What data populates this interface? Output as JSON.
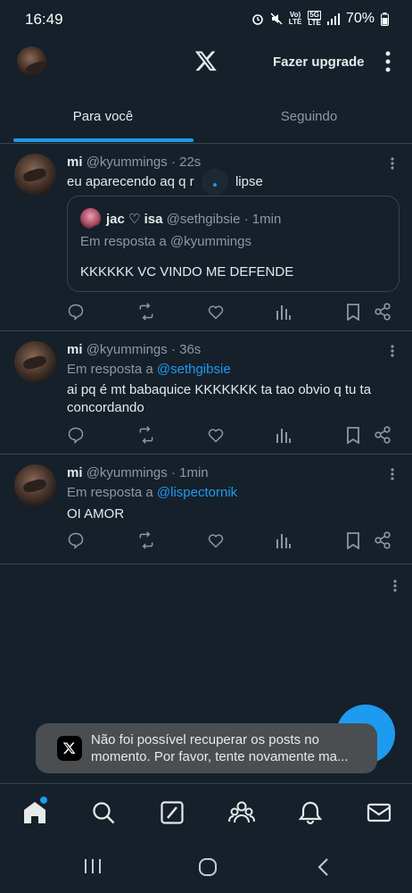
{
  "status_bar": {
    "time": "16:49",
    "volte_top": "Vo)",
    "volte_bottom": "LTE",
    "net_top": "5G",
    "net_bottom": "LTE",
    "battery": "70%"
  },
  "header": {
    "logo": "x-logo-icon",
    "upgrade_label": "Fazer upgrade"
  },
  "tabs": [
    {
      "label": "Para você",
      "active": true
    },
    {
      "label": "Seguindo",
      "active": false
    }
  ],
  "posts": [
    {
      "name": "mi",
      "handle": "@kyummings",
      "time": "· 22s",
      "text": "eu aparecendo aq q r",
      "text_tail": "lipse",
      "quote": {
        "name": "jac ♡ isa",
        "handle": "@sethgibsie",
        "time": "· 1min",
        "reply_line": "Em resposta a @kyummings",
        "text": "KKKKKK  VC VINDO ME DEFENDE"
      }
    },
    {
      "name": "mi",
      "handle": "@kyummings",
      "time": "· 36s",
      "reply_prefix": "Em resposta a",
      "reply_to": "@sethgibsie",
      "text": "ai pq é mt babaquice KKKKKKK ta tao obvio q tu ta concordando"
    },
    {
      "name": "mi",
      "handle": "@kyummings",
      "time": "· 1min",
      "reply_prefix": "Em resposta a",
      "reply_to": "@lispectornik",
      "text": "OI AMOR"
    }
  ],
  "toast": {
    "message": "Não foi possível recuperar os posts no momento. Por favor, tente novamente ma..."
  },
  "colors": {
    "background": "#15202b",
    "accent": "#1d9bf0",
    "divider": "#38444d",
    "secondary_text": "#8b98a5"
  }
}
